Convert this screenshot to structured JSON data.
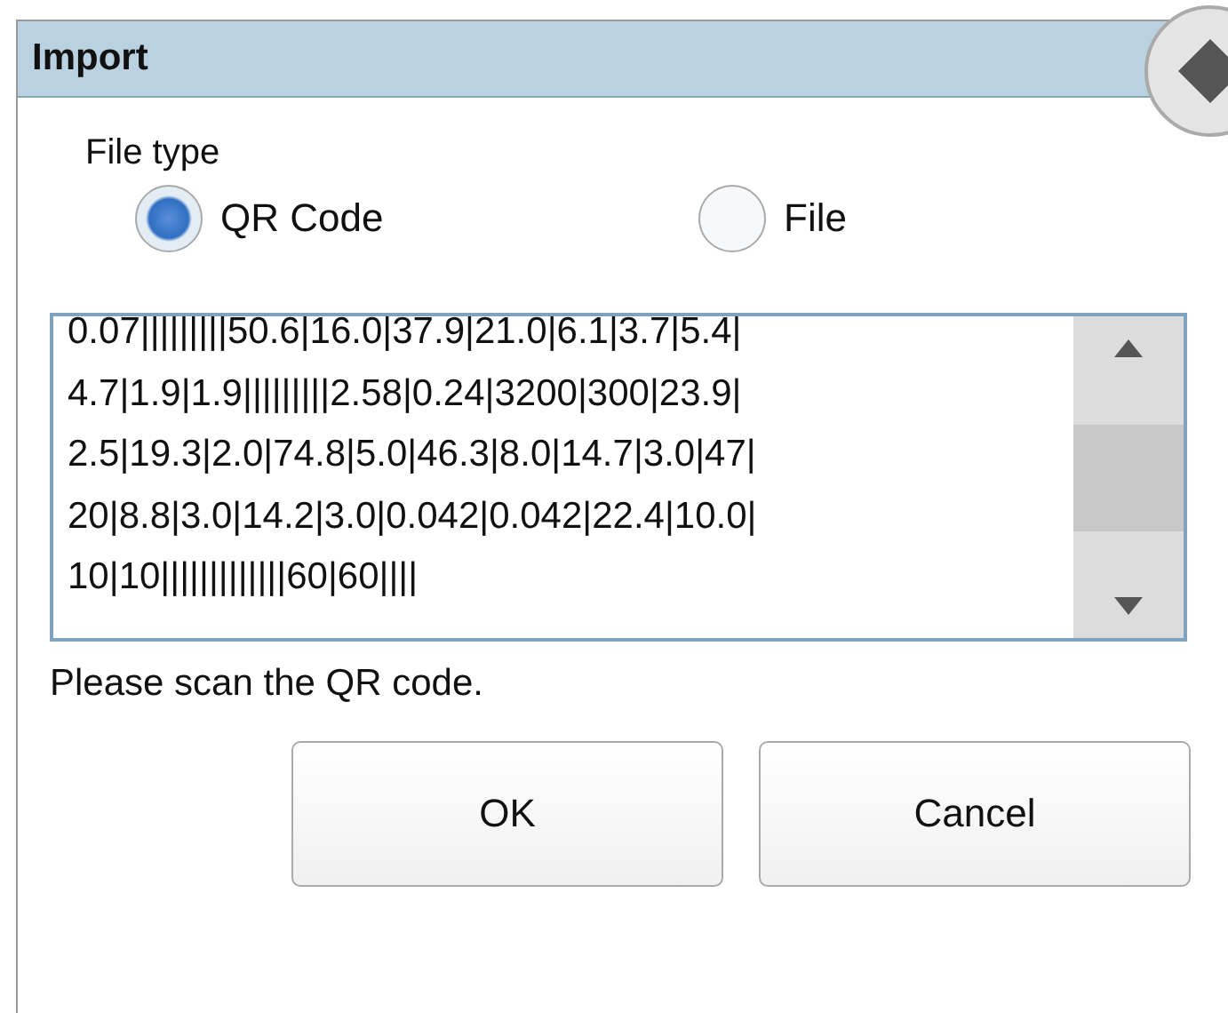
{
  "window": {
    "title": "Import"
  },
  "file_type": {
    "label": "File type",
    "options": [
      {
        "label": "QR Code",
        "selected": true
      },
      {
        "label": "File",
        "selected": false
      }
    ]
  },
  "text_area": {
    "lines": [
      "0.07|||||||||50.6|16.0|37.9|21.0|6.1|3.7|5.4|",
      "4.7|1.9|1.9|||||||||2.58|0.24|3200|300|23.9|",
      "2.5|19.3|2.0|74.8|5.0|46.3|8.0|14.7|3.0|47|",
      "20|8.8|3.0|14.2|3.0|0.042|0.042|22.4|10.0|",
      "10|10|||||||||||||60|60||||"
    ]
  },
  "status": "Please scan the QR code.",
  "buttons": [
    "OK",
    "Cancel"
  ]
}
